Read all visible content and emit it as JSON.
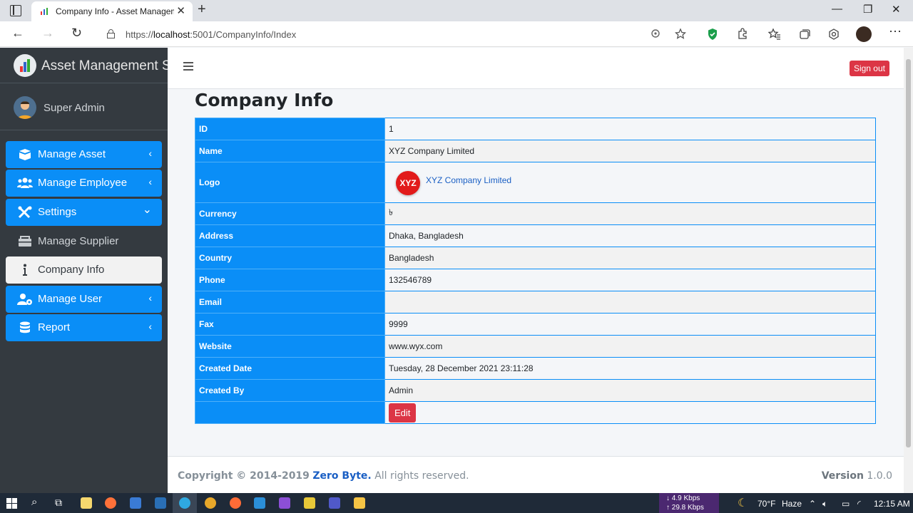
{
  "browser": {
    "tab_title": "Company Info - Asset Managem",
    "url_prefix": "https://",
    "url_host": "localhost",
    "url_rest": ":5001/CompanyInfo/Index"
  },
  "sidebar": {
    "brand": "Asset Management Sys",
    "user": "Super Admin",
    "items": [
      {
        "label": "Manage Asset",
        "icon": "box-open-icon",
        "arrow": "‹"
      },
      {
        "label": "Manage Employee",
        "icon": "users-icon",
        "arrow": "‹"
      },
      {
        "label": "Settings",
        "icon": "tools-icon",
        "arrow": "⌄"
      },
      {
        "label": "Manage Supplier",
        "icon": "truck-icon"
      },
      {
        "label": "Company Info",
        "icon": "info-icon"
      },
      {
        "label": "Manage User",
        "icon": "user-cog-icon",
        "arrow": "‹"
      },
      {
        "label": "Report",
        "icon": "database-icon",
        "arrow": "‹"
      }
    ]
  },
  "topnav": {
    "signout": "Sign out"
  },
  "page": {
    "title": "Company Info",
    "rows": [
      {
        "key": "ID",
        "value": "1"
      },
      {
        "key": "Name",
        "value": "XYZ Company Limited"
      },
      {
        "key": "Logo",
        "logo_text": "XYZ",
        "logo_label": "XYZ Company Limited"
      },
      {
        "key": "Currency",
        "value": "৳"
      },
      {
        "key": "Address",
        "value": "Dhaka, Bangladesh"
      },
      {
        "key": "Country",
        "value": "Bangladesh"
      },
      {
        "key": "Phone",
        "value": "132546789"
      },
      {
        "key": "Email",
        "value": ""
      },
      {
        "key": "Fax",
        "value": "9999"
      },
      {
        "key": "Website",
        "value": "www.wyx.com"
      },
      {
        "key": "Created Date",
        "value": "Tuesday, 28 December 2021 23:11:28"
      },
      {
        "key": "Created By",
        "value": "Admin"
      }
    ],
    "edit_label": "Edit"
  },
  "footer": {
    "copyright": "Copyright © 2014-2019",
    "brand": "Zero Byte.",
    "rights": "All rights reserved.",
    "version_label": "Version",
    "version": "1.0.0"
  },
  "taskbar": {
    "down_speed": "↓ 4.9 Kbps",
    "up_speed": "↑ 29.8 Kbps",
    "temp": "70°F",
    "weather": "Haze",
    "time": "12:15 AM"
  },
  "colors": {
    "accent": "#0a8ef7",
    "danger": "#dc3545",
    "sidebar": "#343a40"
  }
}
